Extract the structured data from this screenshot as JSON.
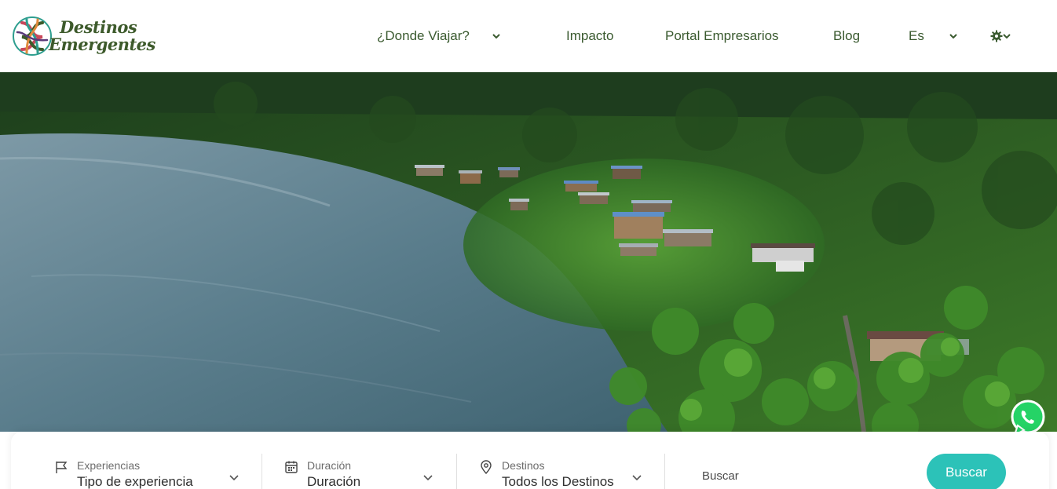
{
  "brand": {
    "line1": "Destinos",
    "line2": "Emergentes",
    "color": "#3d5a2b",
    "logo_icon": "woven-knot-logo"
  },
  "nav": {
    "items": [
      {
        "label": "¿Donde Viajar?",
        "has_dropdown": true
      },
      {
        "label": "Impacto",
        "has_dropdown": false
      },
      {
        "label": "Portal Empresarios",
        "has_dropdown": false
      },
      {
        "label": "Blog",
        "has_dropdown": false
      },
      {
        "label": "Es",
        "has_dropdown": true
      }
    ],
    "settings_icon": "gear-icon"
  },
  "hero": {
    "image": "aerial-river-jungle-village"
  },
  "search": {
    "experiencias": {
      "label": "Experiencias",
      "value": "Tipo de experiencia",
      "icon": "flag-icon"
    },
    "duracion": {
      "label": "Duración",
      "value": "Duración",
      "icon": "calendar-icon"
    },
    "destinos": {
      "label": "Destinos",
      "value": "Todos los Destinos",
      "icon": "map-pin-icon"
    },
    "placeholder": "Buscar",
    "button_label": "Buscar",
    "button_color": "#2cc2b8"
  },
  "floating": {
    "whatsapp_icon": "whatsapp-icon",
    "whatsapp_color": "#25d366"
  }
}
